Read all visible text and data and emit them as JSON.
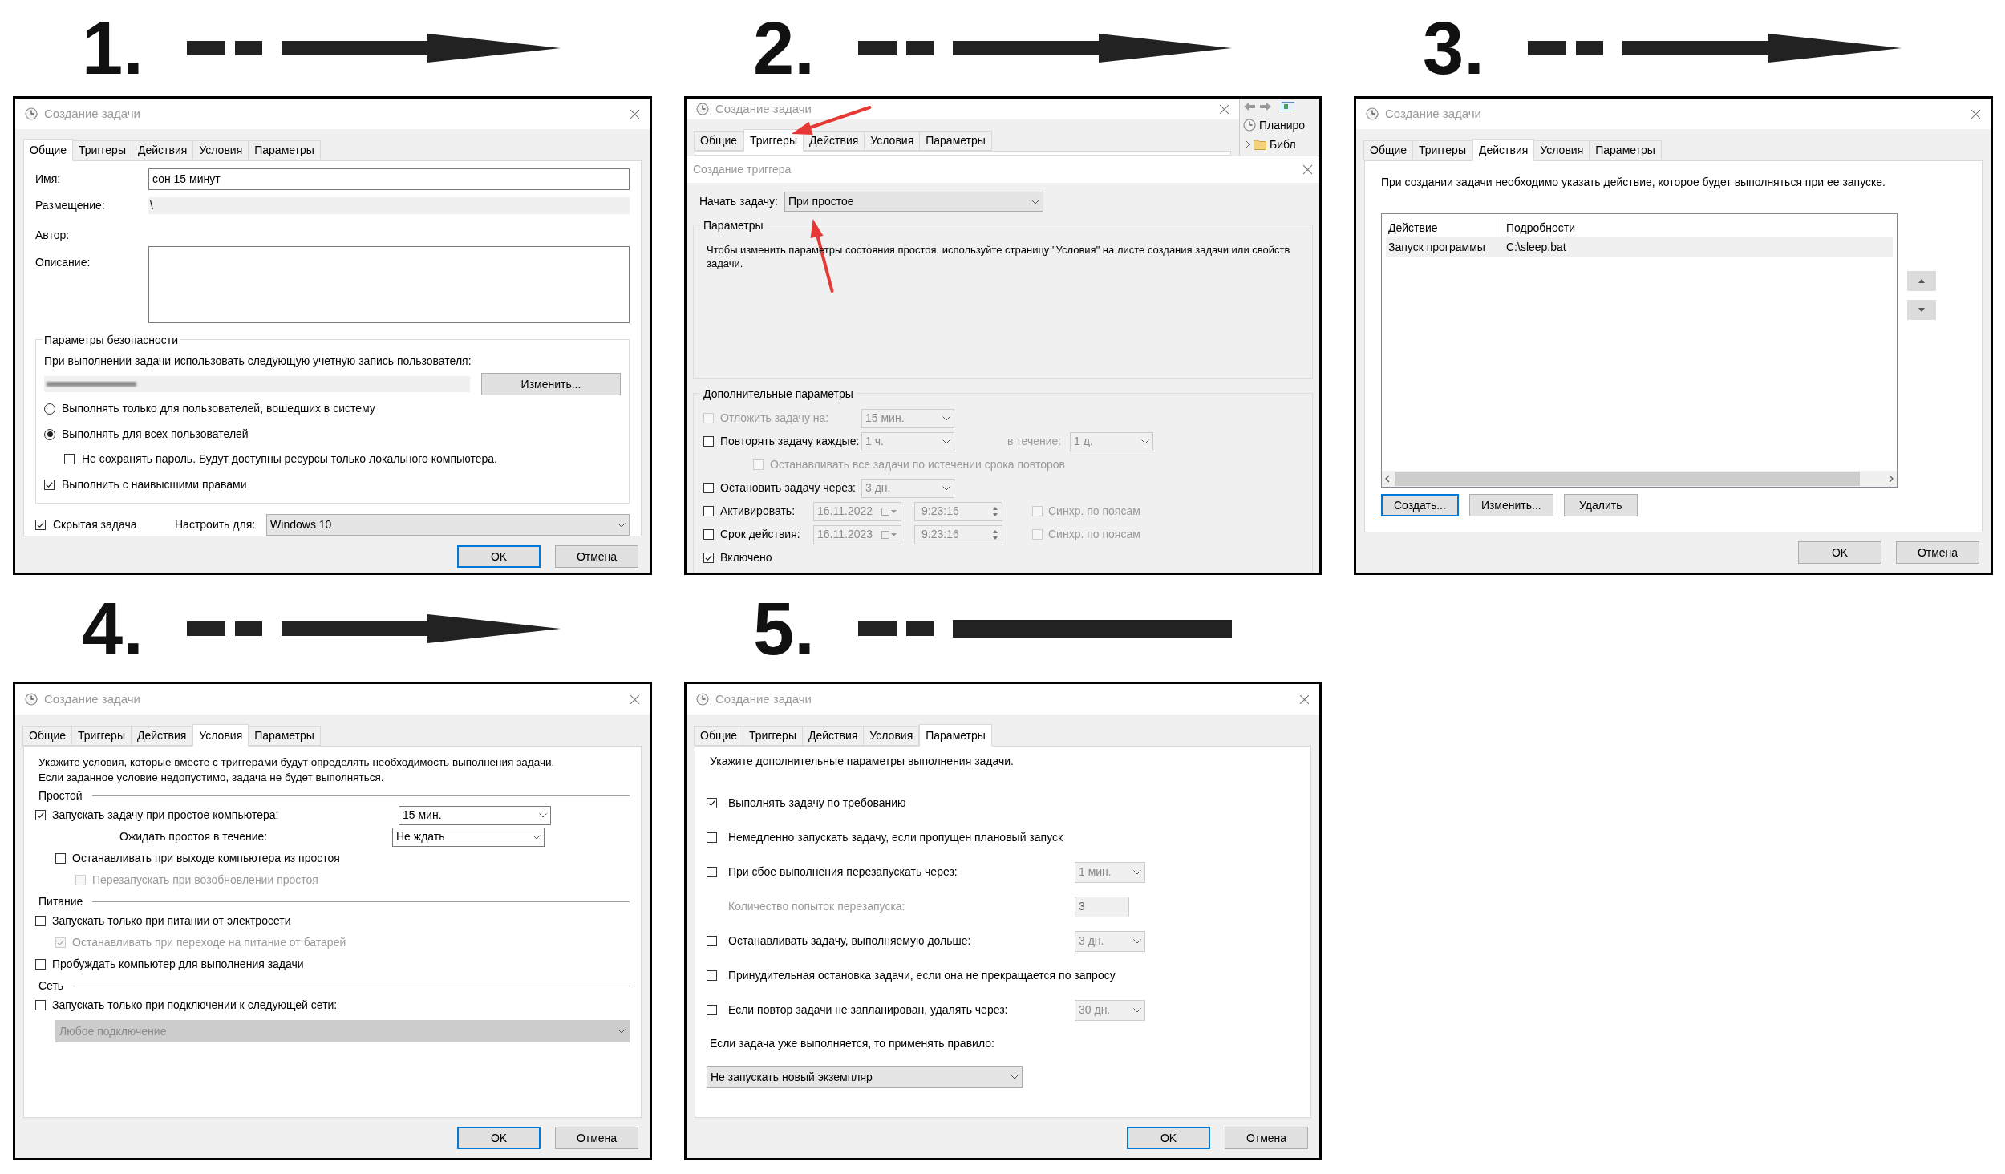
{
  "steps": [
    {
      "number": "1.",
      "arrow_head": true,
      "dialog": {
        "kind": "general",
        "title": "Создание задачи",
        "tabs": [
          {
            "label": "Общие",
            "selected": true
          },
          {
            "label": "Триггеры",
            "selected": false
          },
          {
            "label": "Действия",
            "selected": false
          },
          {
            "label": "Условия",
            "selected": false
          },
          {
            "label": "Параметры",
            "selected": false
          }
        ],
        "name_label": "Имя:",
        "name_value": "сон 15 минут",
        "location_label": "Размещение:",
        "location_value": "\\",
        "author_label": "Автор:",
        "description_label": "Описание:",
        "security": {
          "title": "Параметры безопасности",
          "prompt": "При выполнении задачи использовать следующую учетную запись пользователя:",
          "change_button": "Изменить...",
          "radios": [
            {
              "label": "Выполнять только для пользователей, вошедших в систему",
              "selected": false
            },
            {
              "label": "Выполнять для всех пользователей",
              "selected": true,
              "children": [
                {
                  "label": "Не сохранять пароль. Будут доступны ресурсы только локального компьютера.",
                  "checked": false
                }
              ]
            }
          ],
          "highest": {
            "label": "Выполнить с наивысшими правами",
            "checked": true
          }
        },
        "hidden": {
          "label": "Скрытая задача",
          "checked": true
        },
        "configure_label": "Настроить для:",
        "configure_value": "Windows 10",
        "buttons": [
          {
            "label": "OK",
            "default": true
          },
          {
            "label": "Отмена",
            "default": false
          }
        ]
      }
    },
    {
      "number": "2.",
      "arrow_head": true,
      "dialog": {
        "kind": "trigger",
        "title": "Создание задачи",
        "tabs": [
          {
            "label": "Общие",
            "selected": false
          },
          {
            "label": "Триггеры",
            "selected": true
          },
          {
            "label": "Действия",
            "selected": false
          },
          {
            "label": "Условия",
            "selected": false
          },
          {
            "label": "Параметры",
            "selected": false
          }
        ],
        "side_items": [
          "Планиро",
          "Библ"
        ],
        "trigger": {
          "title": "Создание триггера",
          "begin_label": "Начать задачу:",
          "begin_value": "При простое",
          "params_title": "Параметры",
          "note": "Чтобы изменить параметры состояния простоя, используйте страницу \"Условия\" на листе создания задачи или свойств задачи.",
          "advanced_title": "Дополнительные параметры",
          "rows": [
            {
              "kind": "checkbox-select",
              "label": "Отложить задачу на:",
              "checked": false,
              "disabled": true,
              "select": {
                "value": "15 мин.",
                "disabled": true
              }
            },
            {
              "kind": "checkbox-select",
              "label": "Повторять задачу каждые:",
              "checked": false,
              "disabled": false,
              "select": {
                "value": "1 ч.",
                "disabled": true
              },
              "during_label": "в течение:",
              "during_select": {
                "value": "1 д.",
                "disabled": true
              },
              "children": [
                {
                  "kind": "checkbox",
                  "label": "Останавливать все задачи по истечении срока повторов",
                  "checked": false,
                  "disabled": true
                }
              ]
            },
            {
              "kind": "checkbox-select",
              "label": "Остановить задачу через:",
              "checked": false,
              "disabled": false,
              "select": {
                "value": "3 дн.",
                "disabled": true
              }
            },
            {
              "kind": "checkbox-datetime",
              "label": "Активировать:",
              "checked": false,
              "disabled": false,
              "date": "16.11.2022",
              "time": "9:23:16",
              "sync": {
                "label": "Синхр. по поясам",
                "checked": false,
                "disabled": true
              }
            },
            {
              "kind": "checkbox-datetime",
              "label": "Срок действия:",
              "checked": false,
              "disabled": false,
              "date": "16.11.2023",
              "time": "9:23:16",
              "sync": {
                "label": "Синхр. по поясам",
                "checked": false,
                "disabled": true
              }
            },
            {
              "kind": "checkbox",
              "label": "Включено",
              "checked": true,
              "disabled": false
            }
          ]
        }
      }
    },
    {
      "number": "3.",
      "arrow_head": true,
      "dialog": {
        "kind": "actions",
        "title": "Создание задачи",
        "tabs": [
          {
            "label": "Общие",
            "selected": false
          },
          {
            "label": "Триггеры",
            "selected": false
          },
          {
            "label": "Действия",
            "selected": true
          },
          {
            "label": "Условия",
            "selected": false
          },
          {
            "label": "Параметры",
            "selected": false
          }
        ],
        "intro": "При создании задачи необходимо указать действие, которое будет выполняться при ее запуске.",
        "columns": [
          "Действие",
          "Подробности"
        ],
        "rows": [
          {
            "cells": [
              "Запуск программы",
              "C:\\sleep.bat"
            ],
            "selected": true
          }
        ],
        "list_buttons": [
          {
            "label": "Создать...",
            "focused": true
          },
          {
            "label": "Изменить...",
            "focused": false
          },
          {
            "label": "Удалить",
            "focused": false
          }
        ],
        "buttons": [
          {
            "label": "OK",
            "default": false
          },
          {
            "label": "Отмена",
            "default": false
          }
        ]
      }
    },
    {
      "number": "4.",
      "arrow_head": true,
      "dialog": {
        "kind": "conditions",
        "title": "Создание задачи",
        "tabs": [
          {
            "label": "Общие",
            "selected": false
          },
          {
            "label": "Триггеры",
            "selected": false
          },
          {
            "label": "Действия",
            "selected": false
          },
          {
            "label": "Условия",
            "selected": true
          },
          {
            "label": "Параметры",
            "selected": false
          }
        ],
        "intro_lines": [
          "Укажите условия, которые вместе с триггерами будут определять необходимость выполнения задачи.",
          "Если заданное условие недопустимо, задача не будет выполняться."
        ],
        "sections": [
          {
            "title": "Простой",
            "items": [
              {
                "kind": "checkbox",
                "label": "Запускать задачу при простое компьютера:",
                "checked": true,
                "disabled": false,
                "select": {
                  "value": "15 мин.",
                  "disabled": false
                },
                "children": [
                  {
                    "kind": "label-select",
                    "label": "Ожидать простоя в течение:",
                    "select": {
                      "value": "Не ждать",
                      "disabled": false
                    }
                  },
                  {
                    "kind": "checkbox",
                    "label": "Останавливать при выходе компьютера из простоя",
                    "checked": false,
                    "disabled": false,
                    "children": [
                      {
                        "kind": "checkbox",
                        "label": "Перезапускать при возобновлении простоя",
                        "checked": false,
                        "disabled": true
                      }
                    ]
                  }
                ]
              }
            ]
          },
          {
            "title": "Питание",
            "items": [
              {
                "kind": "checkbox",
                "label": "Запускать только при питании от электросети",
                "checked": false,
                "disabled": false,
                "children": [
                  {
                    "kind": "checkbox",
                    "label": "Останавливать при переходе на питание от батарей",
                    "checked": true,
                    "disabled": true
                  }
                ]
              },
              {
                "kind": "checkbox",
                "label": "Пробуждать компьютер для выполнения задачи",
                "checked": false,
                "disabled": false
              }
            ]
          },
          {
            "title": "Сеть",
            "items": [
              {
                "kind": "checkbox",
                "label": "Запускать только при подключении к следующей сети:",
                "checked": false,
                "disabled": false,
                "children": [
                  {
                    "kind": "select",
                    "select": {
                      "value": "Любое подключение",
                      "disabled": true
                    }
                  }
                ]
              }
            ]
          }
        ],
        "buttons": [
          {
            "label": "OK",
            "default": true
          },
          {
            "label": "Отмена",
            "default": false
          }
        ]
      }
    },
    {
      "number": "5.",
      "arrow_head": false,
      "dialog": {
        "kind": "settings",
        "title": "Создание задачи",
        "tabs": [
          {
            "label": "Общие",
            "selected": false
          },
          {
            "label": "Триггеры",
            "selected": false
          },
          {
            "label": "Действия",
            "selected": false
          },
          {
            "label": "Условия",
            "selected": false
          },
          {
            "label": "Параметры",
            "selected": true
          }
        ],
        "intro": "Укажите дополнительные параметры выполнения задачи.",
        "items": [
          {
            "kind": "checkbox",
            "label": "Выполнять задачу по требованию",
            "checked": true,
            "disabled": false
          },
          {
            "kind": "checkbox",
            "label": "Немедленно запускать задачу, если пропущен плановый запуск",
            "checked": false,
            "disabled": false
          },
          {
            "kind": "checkbox",
            "label": "При сбое выполнения перезапускать через:",
            "checked": false,
            "disabled": false,
            "select": {
              "value": "1 мин.",
              "disabled": true
            }
          },
          {
            "kind": "label-input",
            "label": "Количество попыток перезапуска:",
            "value": "3",
            "disabled": true
          },
          {
            "kind": "checkbox",
            "label": "Останавливать задачу, выполняемую дольше:",
            "checked": false,
            "disabled": false,
            "select": {
              "value": "3 дн.",
              "disabled": true
            }
          },
          {
            "kind": "checkbox",
            "label": "Принудительная остановка задачи, если она не прекращается по запросу",
            "checked": false,
            "disabled": false
          },
          {
            "kind": "checkbox",
            "label": "Если повтор задачи не запланирован, удалять через:",
            "checked": false,
            "disabled": false,
            "select": {
              "value": "30 дн.",
              "disabled": true
            }
          },
          {
            "kind": "label",
            "label": "Если задача уже выполняется, то применять правило:"
          },
          {
            "kind": "select",
            "select": {
              "value": "Не запускать новый экземпляр",
              "disabled": false
            }
          }
        ],
        "buttons": [
          {
            "label": "OK",
            "default": true
          },
          {
            "label": "Отмена",
            "default": false
          }
        ]
      }
    }
  ]
}
